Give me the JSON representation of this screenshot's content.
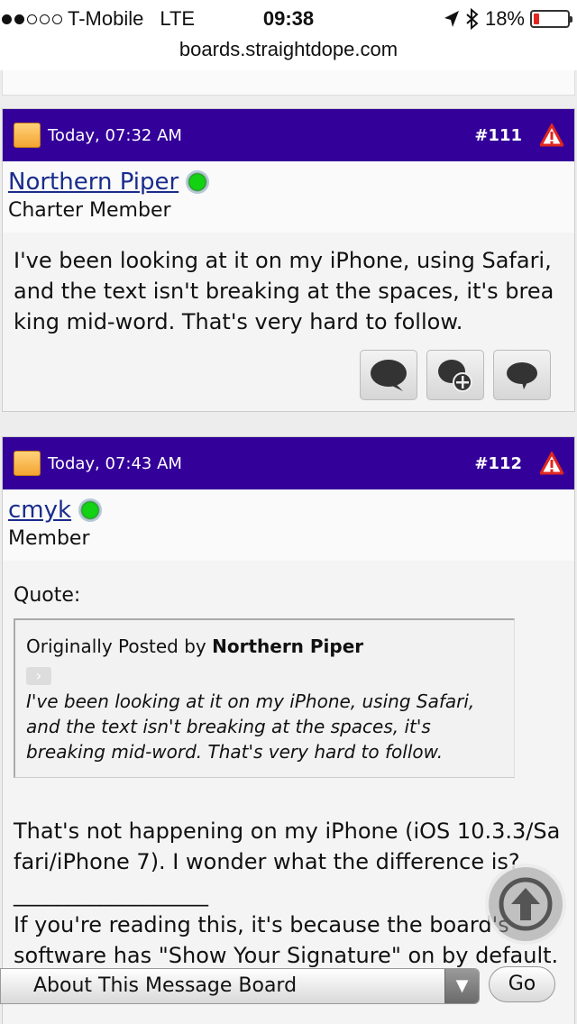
{
  "status": {
    "carrier": "T-Mobile",
    "network": "LTE",
    "time": "09:38",
    "battery": "18%",
    "battery_level": 0.18
  },
  "url": "boards.straightdope.com",
  "posts": [
    {
      "date": "Today, 07:32 AM",
      "number": "#111",
      "username": "Northern Piper",
      "usertitle": "Charter Member",
      "body": "I've been looking at it on my iPhone, using Safari, and the text isn't breaking at the spaces, it's breaking mid-word. That's very hard to follow."
    },
    {
      "date": "Today, 07:43 AM",
      "number": "#112",
      "username": "cmyk",
      "usertitle": "Member",
      "quote_label": "Quote:",
      "quote_prefix": "Originally Posted by",
      "quote_author": "Northern Piper",
      "quote_text": "I've been looking at it on my iPhone, using Safari, and the text isn't breaking at the spaces, it's breaking mid-word. That's very hard to follow.",
      "body": "That's not happening on my iPhone (iOS 10.3.3/Safari/iPhone 7). I wonder what the difference is?",
      "sig_line": "__________________",
      "signature": "If you're reading this, it's because the board's software has \"Show Your Signature\" on by default."
    }
  ],
  "footer": {
    "select_value": "About This Message Board",
    "go_label": "Go"
  },
  "icons": {
    "reply": "speech-bubble-icon",
    "quote_reply": "multi-quote-icon",
    "quick_reply": "quick-reply-icon",
    "report": "warning-triangle-icon",
    "scroll_top": "arrow-up-icon"
  },
  "colors": {
    "post_header": "#330099",
    "link": "#1a2c8c",
    "online": "#12d212"
  }
}
